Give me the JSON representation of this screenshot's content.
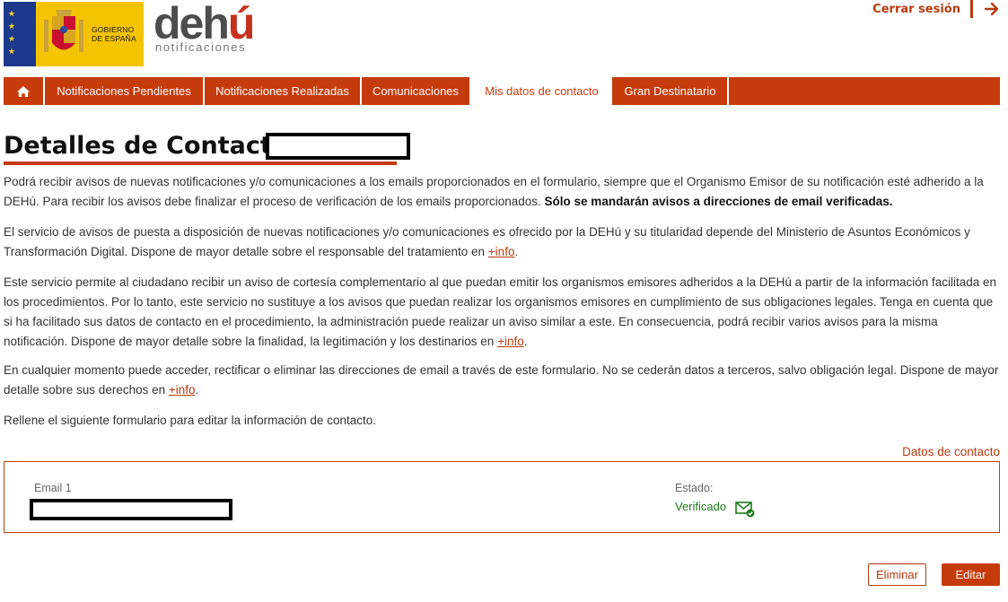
{
  "header": {
    "gov_logo_text": [
      "GOBIERNO",
      "DE ESPAÑA"
    ],
    "app_logo_main": "dehú",
    "app_logo_sub": "notificaciones",
    "logout_label": "Cerrar sesión"
  },
  "nav": {
    "items": [
      {
        "label": "Notificaciones Pendientes"
      },
      {
        "label": "Notificaciones Realizadas"
      },
      {
        "label": "Comunicaciones"
      },
      {
        "label": "Mis datos de contacto"
      },
      {
        "label": "Gran Destinatario"
      }
    ],
    "active_index": 3
  },
  "page": {
    "title": "Detalles de Contacto -"
  },
  "content": {
    "p1_a": "Podrá recibir avisos de nuevas notificaciones y/o comunicaciones a los emails proporcionados en el formulario, siempre que el Organismo Emisor de su notificación esté adherido a la DEHú. Para recibir los avisos debe finalizar el proceso de verificación de los emails proporcionados. ",
    "p1_bold": "Sólo se mandarán avisos a direcciones de email verificadas.",
    "p2": "El servicio de avisos de puesta a disposición de nuevas notificaciones y/o comunicaciones es ofrecido por la DEHú y su titularidad depende del Ministerio de Asuntos Económicos y Transformación Digital. Dispone de mayor detalle sobre el responsable del tratamiento en ",
    "p3": "Este servicio permite al ciudadano recibir un aviso de cortesía complementario al que puedan emitir los organismos emisores adheridos a la DEHú a partir de la información facilitada en los procedimientos. Por lo tanto, este servicio no sustituye a los avisos que puedan realizar los organismos emisores en cumplimiento de sus obligaciones legales. Tenga en cuenta que si ha facilitado sus datos de contacto en el procedimiento, la administración puede realizar un aviso similar a este. En consecuencia, podrá recibir varios avisos para la misma notificación. Dispone de mayor detalle sobre la finalidad, la legitimación y los destinarios en ",
    "p4": "En cualquier momento puede acceder, rectificar o eliminar las direcciones de email a través de este formulario. No se cederán datos a terceros, salvo obligación legal. Dispone de mayor detalle sobre sus derechos en ",
    "p5": "Rellene el siguiente formulario para editar la información de contacto.",
    "info_link": "+info",
    "period": "."
  },
  "contact": {
    "section_label": "Datos de contacto",
    "email_label": "Email 1",
    "state_label": "Estado:",
    "state_value": "Verificado"
  },
  "actions": {
    "delete_label": "Eliminar",
    "edit_label": "Editar"
  },
  "colors": {
    "brand": "#c53b0c",
    "verified": "#1e7a1e"
  }
}
